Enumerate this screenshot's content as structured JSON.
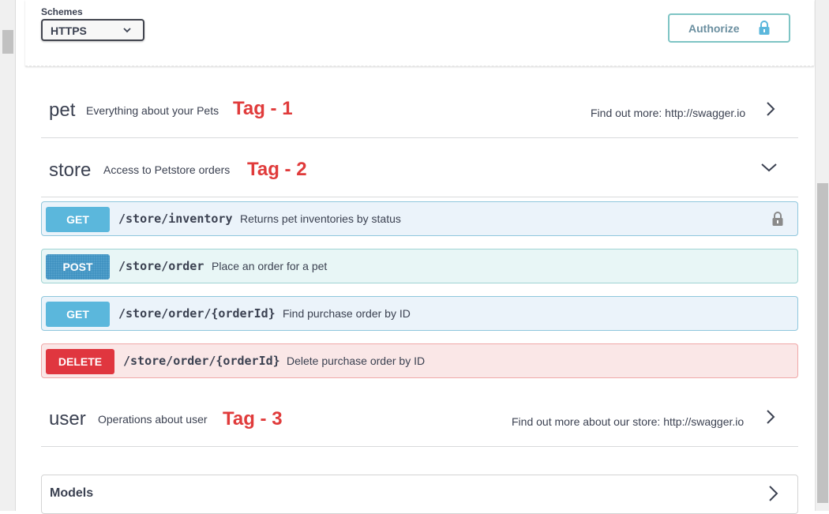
{
  "header": {
    "schemes_label": "Schemes",
    "scheme_selected": "HTTPS",
    "authorize_label": "Authorize"
  },
  "tags": [
    {
      "name": "pet",
      "description": "Everything about your Pets",
      "annotation": "Tag - 1",
      "find_more": "Find out more: http://swagger.io",
      "state": "collapsed"
    },
    {
      "name": "store",
      "description": "Access to Petstore orders",
      "annotation": "Tag - 2",
      "find_more": "",
      "state": "expanded"
    },
    {
      "name": "user",
      "description": "Operations about user",
      "annotation": "Tag - 3",
      "find_more": "Find out more about our store: http://swagger.io",
      "state": "collapsed"
    }
  ],
  "operations": [
    {
      "method": "GET",
      "path": "/store/inventory",
      "summary": "Returns pet inventories by status",
      "locked": true
    },
    {
      "method": "POST",
      "path": "/store/order",
      "summary": "Place an order for a pet",
      "locked": false
    },
    {
      "method": "GET",
      "path": "/store/order/{orderId}",
      "summary": "Find purchase order by ID",
      "locked": false
    },
    {
      "method": "DELETE",
      "path": "/store/order/{orderId}",
      "summary": "Delete purchase order by ID",
      "locked": false
    }
  ],
  "models": {
    "title": "Models"
  },
  "colors": {
    "get": "#5bb7dc",
    "post": "#3c8fbf",
    "delete": "#e0363f",
    "annotation": "#e03b3b"
  },
  "icons": {
    "scheme_dropdown": "chevron-down-icon",
    "authorize": "lock-icon",
    "tag_collapsed": "chevron-right-icon",
    "tag_expanded": "chevron-down-icon",
    "op_lock": "lock-icon"
  }
}
